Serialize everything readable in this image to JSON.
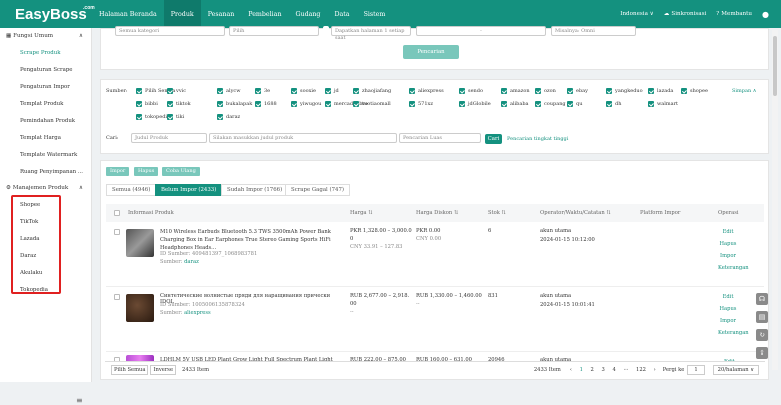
{
  "app": {
    "logo": "EasyBoss",
    "logo_sup": ".com"
  },
  "nav": [
    "Halaman Beranda",
    "Produk",
    "Pesanan",
    "Pembelian",
    "Gudang",
    "Data",
    "Sistem"
  ],
  "topright": {
    "lang": "Indonesia ∨",
    "sync": "Sinkronisasi",
    "help": "Membantu"
  },
  "sidebar": {
    "section1": "Fungsi Umum",
    "items": [
      "Scrape Produk",
      "Pengaturan Scrape",
      "Pengaturan Impor",
      "Templat Produk",
      "Pemindahan Produk",
      "Templat Harga",
      "Template Watermark",
      "Ruang Penyimpanan ..."
    ],
    "section2": "Manajemen Produk",
    "markets": [
      "Shopee",
      "TikTok",
      "Lazada",
      "Daraz",
      "Akulaku",
      "Tokopedia"
    ]
  },
  "filters": {
    "category": "Semua kategori",
    "pilih": "Pilih",
    "dapatkan": "Dapatkan halaman 1 setiap saat",
    "dash": "-",
    "search_placeholder": "Misalnya: Omni",
    "search_btn": "Pencarian"
  },
  "sources": {
    "label": "Sumber:",
    "simpan": "Simpan ∧",
    "row1": [
      "Pilih Semua",
      "vvic",
      "alycw",
      "3e",
      "sooxie",
      "jd",
      "zhaojiafang",
      "aliexpress",
      "sendo",
      "amazon",
      "ozon",
      "ebay",
      "yangkeduo",
      "lazada",
      "shopee"
    ],
    "row2": [
      "bibbi",
      "tiktok",
      "bukalapak",
      "1688",
      "yiwugou",
      "mercadolibre",
      "tuotiaomall",
      "571xz",
      "jdGlobile",
      "alibaba",
      "coupang",
      "qu",
      "dh",
      "walmart"
    ],
    "row3": [
      "tokopedia",
      "tiki",
      "daraz"
    ]
  },
  "cari": {
    "label": "Cari:",
    "field": "Judul Produk",
    "placeholder": "Silakan masukkan judul produk",
    "mode": "Pencarian Luas",
    "btn": "Cari",
    "advanced": "Pencarian tingkat tinggi"
  },
  "actions": [
    "Impor",
    "Hapus",
    "Coba Ulang"
  ],
  "tabs": [
    "Semua (4946)",
    "Belum Impor (2433)",
    "Sudah Impor (1766)",
    "Scrape Gagal (747)"
  ],
  "table": {
    "headers": [
      "Informasi Produk",
      "Harga ⇅",
      "Harga Diskon ⇅",
      "Stok ⇅",
      "Operator/Waktu/Catatan ⇅",
      "Platform Impor",
      "Operasi"
    ],
    "rows": [
      {
        "title": "M10 Wireless Earbuds Bluetooth 5.3 TWS 3500mAh Power Bank Charging Box in Ear Earphones True Stereo Gaming Sports HiFi Headphones Heads...",
        "id": "ID Sumber: 409481397_1068983781",
        "source": "daraz",
        "price1": "PKR 1,328.00 – 3,000.0",
        "price2": "0",
        "price3": "CNY 33.91 – 127.83",
        "disc1": "PKR 0.00",
        "disc2": "CNY 0.00",
        "stock": "6",
        "op": "akun utama",
        "time": "2024-01-15 10:12:00",
        "ops": [
          "Edit",
          "Hapus",
          "Impor",
          "Keterangan"
        ]
      },
      {
        "title": "Синтетические волнистые пряди для наращивания прически IDOL",
        "id": "ID Sumber: 1005006135878324",
        "source": "aliexpress",
        "price1": "RUB 2,677.00 – 2,918.",
        "price2": "00",
        "price3": "--",
        "disc1": "RUB 1,330.00 – 1,460.00",
        "disc2": "--",
        "stock": "831",
        "op": "akun utama",
        "time": "2024-01-15 10:01:41",
        "ops": [
          "Edit",
          "Hapus",
          "Impor",
          "Keterangan"
        ]
      },
      {
        "title": "LDHLM 5V USB LED Plant Grow Light Full Spectrum Plant Light Strip Ph",
        "id": "",
        "source": "",
        "price1": "RUB 222.00 – 875.00",
        "price2": "",
        "price3": "",
        "disc1": "RUB 160.00 – 631.00",
        "disc2": "",
        "stock": "20946",
        "op": "akun utama",
        "time": "",
        "ops": [
          "Edit"
        ]
      }
    ]
  },
  "footer": {
    "select_all": "Pilih Semua",
    "invert": "Inverse",
    "count": "2433 Item",
    "count2": "2433 Item",
    "pages": [
      "‹",
      "1",
      "2",
      "3",
      "4",
      "···",
      "122",
      "›"
    ],
    "goto": "Pergi ke",
    "goto_val": "1",
    "per_page": "20/halaman ∨"
  }
}
